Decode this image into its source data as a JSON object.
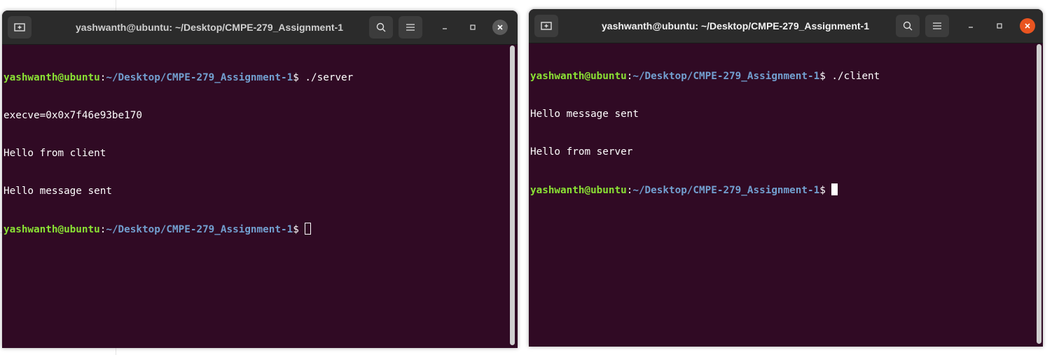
{
  "left_terminal": {
    "title": "yashwanth@ubuntu: ~/Desktop/CMPE-279_Assignment-1",
    "prompt_user": "yashwanth@ubuntu",
    "prompt_sep": ":",
    "prompt_path": "~/Desktop/CMPE-279_Assignment-1",
    "prompt_end": "$ ",
    "command": "./server",
    "output_lines": [
      "execve=0x0x7f46e93be170",
      "Hello from client",
      "Hello message sent"
    ]
  },
  "right_terminal": {
    "title": "yashwanth@ubuntu: ~/Desktop/CMPE-279_Assignment-1",
    "prompt_user": "yashwanth@ubuntu",
    "prompt_sep": ":",
    "prompt_path": "~/Desktop/CMPE-279_Assignment-1",
    "prompt_end": "$ ",
    "command": "./client",
    "output_lines": [
      "Hello message sent",
      "Hello from server"
    ]
  },
  "icons": {
    "new_tab": "plus-icon",
    "search": "search-icon",
    "menu": "hamburger-icon",
    "minimize": "minimize-icon",
    "maximize": "maximize-icon",
    "close": "close-icon"
  },
  "colors": {
    "terminal_bg": "#300a24",
    "titlebar_bg": "#2b2b2b",
    "prompt_user": "#8ae234",
    "prompt_path": "#729fcf",
    "close_active": "#e95420"
  }
}
